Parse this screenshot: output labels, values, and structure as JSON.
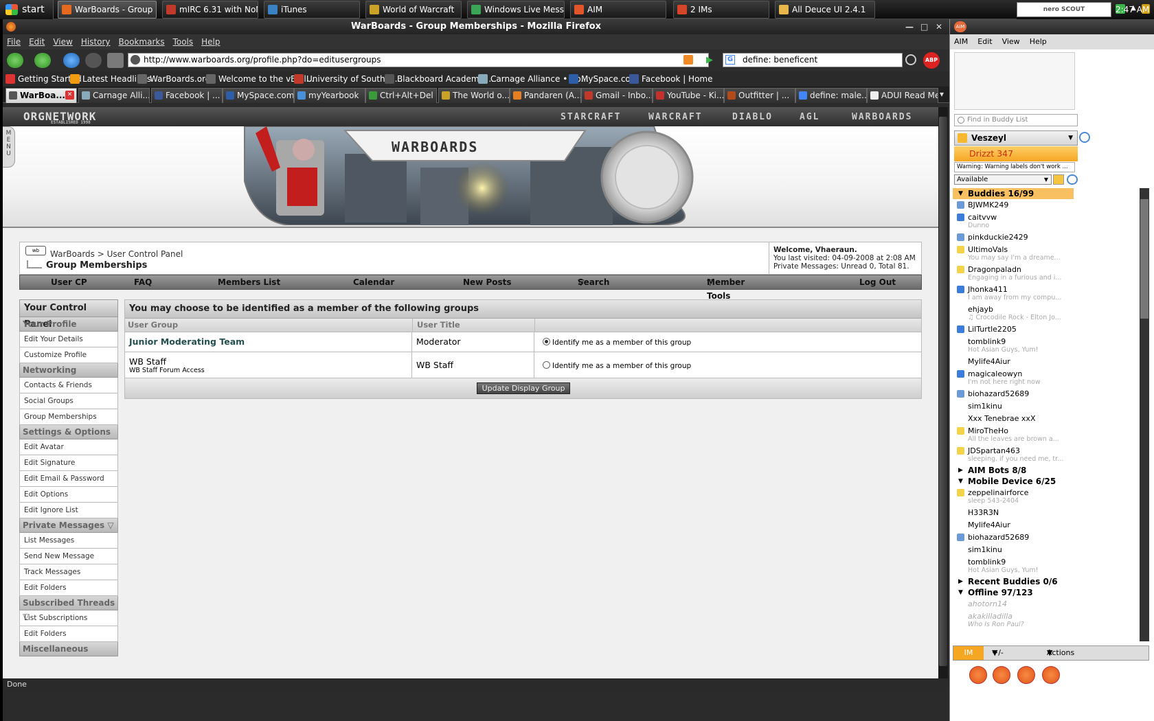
{
  "taskbar": {
    "start_label": "start",
    "tasks": [
      {
        "label": "WarBoards - Group M...",
        "color": "#e56a1f",
        "active": true
      },
      {
        "label": "mIRC 6.31 with NoNa...",
        "color": "#c0392b",
        "active": false
      },
      {
        "label": "iTunes",
        "color": "#3b82c4",
        "active": false
      },
      {
        "label": "World of Warcraft",
        "color": "#c9a227",
        "active": false
      },
      {
        "label": "Windows Live Messen...",
        "color": "#3aa655",
        "active": false
      },
      {
        "label": "AIM",
        "color": "#e0552a",
        "active": false
      },
      {
        "label": "2 IMs",
        "color": "#d6452a",
        "active": false
      },
      {
        "label": "All Deuce UI 2.4.1",
        "color": "#e8b64a",
        "active": false
      }
    ],
    "tray_brand": "nero SCOUT",
    "clock": "2:47 AM"
  },
  "firefox": {
    "window_title": "WarBoards - Group Memberships - Mozilla Firefox",
    "menus": [
      "File",
      "Edit",
      "View",
      "History",
      "Bookmarks",
      "Tools",
      "Help"
    ],
    "url": "http://www.warboards.org/profile.php?do=editusergroups",
    "search_query": "define: beneficent",
    "bookmarks": [
      {
        "label": "Getting Started",
        "color": "#d33"
      },
      {
        "label": "Latest Headlines",
        "color": "#f39c12"
      },
      {
        "label": "WarBoards.org",
        "color": "#666"
      },
      {
        "label": "Welcome to the vBull...",
        "color": "#666"
      },
      {
        "label": "University of South Fl...",
        "color": "#c0392b"
      },
      {
        "label": "Blackboard Academic ...",
        "color": "#555"
      },
      {
        "label": "Carnage Alliance • Bo...",
        "color": "#8ab"
      },
      {
        "label": "MySpace.com",
        "color": "#2f5ea8"
      },
      {
        "label": "Facebook | Home",
        "color": "#3b5998"
      }
    ],
    "tabs": [
      {
        "label": "WarBoa...",
        "color": "#555",
        "active": true
      },
      {
        "label": "Carnage Alli...",
        "color": "#8ab",
        "active": false
      },
      {
        "label": "Facebook | ...",
        "color": "#3b5998",
        "active": false
      },
      {
        "label": "MySpace.com",
        "color": "#2f5ea8",
        "active": false
      },
      {
        "label": "myYearbook",
        "color": "#4a90d9",
        "active": false
      },
      {
        "label": "Ctrl+Alt+Del",
        "color": "#3a9b3a",
        "active": false
      },
      {
        "label": "The World o...",
        "color": "#c9a227",
        "active": false
      },
      {
        "label": "Pandaren (A...",
        "color": "#e67e22",
        "active": false
      },
      {
        "label": "Gmail - Inbo...",
        "color": "#c0392b",
        "active": false
      },
      {
        "label": "YouTube - Ki...",
        "color": "#c4302b",
        "active": false
      },
      {
        "label": "Outfitter | ...",
        "color": "#b34a1a",
        "active": false
      },
      {
        "label": "define: male...",
        "color": "#4285f4",
        "active": false
      },
      {
        "label": "ADUI Read Me",
        "color": "#eee",
        "active": false
      }
    ],
    "status": "Done"
  },
  "site": {
    "org_logo": "ORGNETWORK",
    "org_est": "ESTABLISHED 1998",
    "menu_tab": "MENU",
    "nav": [
      "STARCRAFT",
      "WARCRAFT",
      "DIABLO",
      "AGL",
      "WARBOARDS"
    ],
    "banner_title": "WARBOARDS",
    "breadcrumb": {
      "home": "WarBoards",
      "sep": ">",
      "parent": "User Control Panel",
      "current": "Group Memberships"
    },
    "welcome": {
      "line1_prefix": "Welcome,",
      "username": "Vhaeraun.",
      "line2_prefix": "You last visited:",
      "date": "04-09-2008",
      "at": "at",
      "time": "2:08 AM",
      "line3": "Private Messages: Unread 0, Total 81."
    },
    "top_nav": [
      "User CP",
      "FAQ",
      "Members List",
      "Calendar",
      "New Posts",
      "Search",
      "Member Tools",
      "Log Out"
    ],
    "control_panel": {
      "title": "Your Control Panel",
      "sections": [
        {
          "name": "Your Profile",
          "links": [
            "Edit Your Details",
            "Customize Profile"
          ]
        },
        {
          "name": "Networking",
          "links": [
            "Contacts & Friends",
            "Social Groups",
            "Group Memberships"
          ]
        },
        {
          "name": "Settings & Options",
          "links": [
            "Edit Avatar",
            "Edit Signature",
            "Edit Email & Password",
            "Edit Options",
            "Edit Ignore List"
          ]
        },
        {
          "name": "Private Messages",
          "links": [
            "List Messages",
            "Send New Message",
            "Track Messages",
            "Edit Folders"
          ]
        },
        {
          "name": "Subscribed Threads",
          "links": [
            "List Subscriptions",
            "Edit Folders"
          ]
        },
        {
          "name": "Miscellaneous",
          "links": []
        }
      ]
    },
    "groups": {
      "title": "You may choose to be identified as a member of the following groups",
      "col_group": "User Group",
      "col_title": "User Title",
      "rows": [
        {
          "group": "Junior Moderating Team",
          "desc": "",
          "title": "Moderator",
          "choice": "Identify me as a member of this group",
          "selected": true
        },
        {
          "group": "WB Staff",
          "desc": "WB Staff Forum Access",
          "title": "WB Staff",
          "choice": "Identify me as a member of this group",
          "selected": false
        }
      ],
      "button": "Update Display Group"
    }
  },
  "aim": {
    "menus": [
      "AIM",
      "Edit",
      "View",
      "Help"
    ],
    "find_placeholder": "Find in Buddy List",
    "screen_name": "Veszeyl",
    "alert": "Drizzt 347",
    "warning": "Warning: Warning labels don't work ...",
    "status": "Available",
    "groups": [
      {
        "name": "Buddies 16/99",
        "open": true,
        "highlight": true,
        "buddies": [
          {
            "name": "BJWMK249",
            "status": "",
            "icon": "#6c9ad6"
          },
          {
            "name": "caitvvw",
            "status": "Dunno",
            "icon": "#3b7dd8"
          },
          {
            "name": "pinkduckie2429",
            "status": "",
            "icon": "#6c9ad6"
          },
          {
            "name": "UltimoVals",
            "status": "You may say I'm a dreame...",
            "icon": "#f3d34a"
          },
          {
            "name": "Dragonpaladn",
            "status": "Engaging in a furious and i...",
            "icon": "#f3d34a"
          },
          {
            "name": "Jhonka411",
            "status": "I am away from my compu...",
            "icon": "#3b7dd8"
          },
          {
            "name": "ehjayb",
            "status": "♫ Crocodile Rock - Elton Jo...",
            "icon": ""
          },
          {
            "name": "LilTurtle2205",
            "status": "",
            "icon": "#3b7dd8"
          },
          {
            "name": "tomblink9",
            "status": "Hot Asian Guys, Yum!",
            "icon": ""
          },
          {
            "name": "Mylife4Aiur",
            "status": "",
            "icon": ""
          },
          {
            "name": "magicaleowyn",
            "status": "I'm not here right now",
            "icon": "#3b7dd8"
          },
          {
            "name": "biohazard52689",
            "status": "",
            "icon": "#6c9ad6"
          },
          {
            "name": "sim1kinu",
            "status": "",
            "icon": ""
          },
          {
            "name": "Xxx Tenebrae xxX",
            "status": "",
            "icon": ""
          },
          {
            "name": "MiroTheHo",
            "status": "All the leaves are brown a...",
            "icon": "#f3d34a"
          },
          {
            "name": "JDSpartan463",
            "status": "sleeping. if you need me, tr...",
            "icon": "#f3d34a"
          }
        ]
      },
      {
        "name": "AIM Bots 8/8",
        "open": false,
        "highlight": false,
        "buddies": []
      },
      {
        "name": "Mobile Device 6/25",
        "open": true,
        "highlight": false,
        "buddies": [
          {
            "name": "zeppelinairforce",
            "status": "sleep 543-2404",
            "icon": "#f3d34a"
          },
          {
            "name": "H33R3N",
            "status": "",
            "icon": ""
          },
          {
            "name": "Mylife4Aiur",
            "status": "",
            "icon": ""
          },
          {
            "name": "biohazard52689",
            "status": "",
            "icon": "#6c9ad6"
          },
          {
            "name": "sim1kinu",
            "status": "",
            "icon": ""
          },
          {
            "name": "tomblink9",
            "status": "Hot Asian Guys, Yum!",
            "icon": ""
          }
        ]
      },
      {
        "name": "Recent Buddies 0/6",
        "open": false,
        "highlight": false,
        "buddies": []
      },
      {
        "name": "Offline 97/123",
        "open": true,
        "highlight": false,
        "buddies": [
          {
            "name": "ahotorn14",
            "status": "",
            "icon": "",
            "offline": true
          },
          {
            "name": "akakilladilla",
            "status": "Who Is Ron Paul?",
            "icon": "",
            "offline": true
          }
        ]
      }
    ],
    "footer": {
      "im": "IM",
      "plusminus": "+/-",
      "actions": "Actions"
    }
  }
}
